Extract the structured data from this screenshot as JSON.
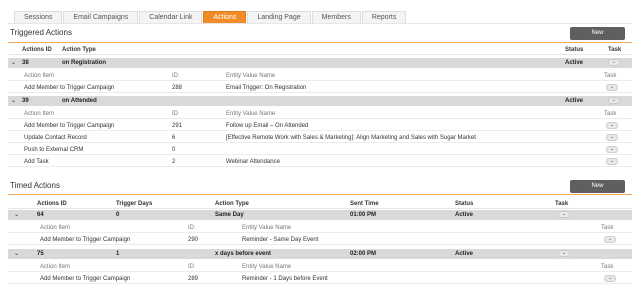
{
  "tabs": [
    "Sessions",
    "Email Campaigns",
    "Calendar Link",
    "Actions",
    "Landing Page",
    "Members",
    "Reports"
  ],
  "triggered": {
    "title": "Triggered Actions",
    "new_label": "New",
    "headers": {
      "actions_id": "Actions ID",
      "action_type": "Action Type",
      "status": "Status",
      "task": "Task"
    },
    "sub_headers": {
      "action_item": "Action Item",
      "id": "ID",
      "entity": "Entity Value Name",
      "task": "Task"
    },
    "groups": [
      {
        "id": "38",
        "type": "on Registration",
        "status": "Active",
        "items": [
          {
            "item": "Add Member to Trigger Campaign",
            "id": "288",
            "entity": "Email Trigger: On Registration"
          }
        ]
      },
      {
        "id": "39",
        "type": "on Attended",
        "status": "Active",
        "items": [
          {
            "item": "Add Member to Trigger Campaign",
            "id": "291",
            "entity": "Follow up Email – On Attended"
          },
          {
            "item": "Update Contact Record",
            "id": "6",
            "entity": "[Effective Remote Work with Sales & Marketing]: Align Marketing and Sales with Sugar Market"
          },
          {
            "item": "Push to External CRM",
            "id": "0",
            "entity": ""
          },
          {
            "item": "Add Task",
            "id": "2",
            "entity": "Webinar Attendance"
          }
        ]
      }
    ]
  },
  "timed": {
    "title": "Timed Actions",
    "new_label": "New",
    "headers": {
      "actions_id": "Actions ID",
      "trigger_days": "Trigger Days",
      "action_type": "Action Type",
      "sent_time": "Sent Time",
      "status": "Status",
      "task": "Task"
    },
    "sub_headers": {
      "action_item": "Action Item",
      "id": "ID",
      "entity": "Entity Value Name",
      "task": "Task"
    },
    "groups": [
      {
        "id": "64",
        "days": "0",
        "type": "Same Day",
        "time": "01:00 PM",
        "status": "Active",
        "items": [
          {
            "item": "Add Member to Trigger Campaign",
            "id": "290",
            "entity": "Reminder - Same Day Event"
          }
        ]
      },
      {
        "id": "75",
        "days": "1",
        "type": "x days before event",
        "time": "02:00 PM",
        "status": "Active",
        "items": [
          {
            "item": "Add Member to Trigger Campaign",
            "id": "289",
            "entity": "Reminder - 1 Days before Event"
          }
        ]
      }
    ]
  }
}
